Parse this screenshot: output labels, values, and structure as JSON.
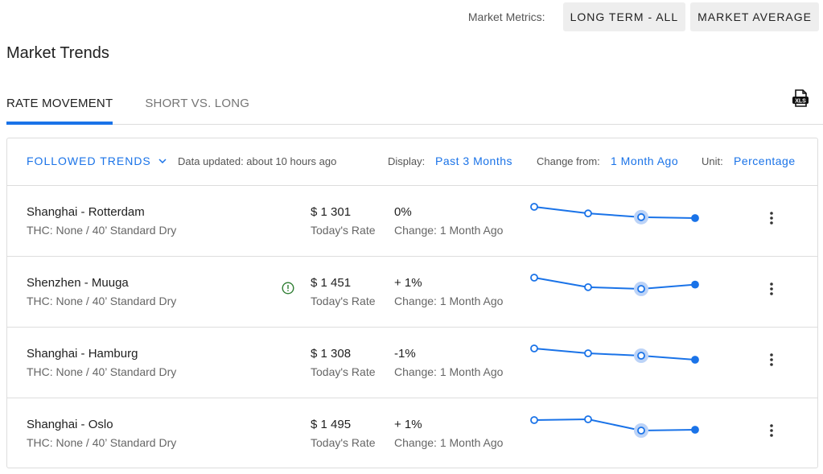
{
  "header": {
    "metrics_label": "Market Metrics:",
    "buttons": [
      "LONG TERM - ALL",
      "MARKET AVERAGE"
    ]
  },
  "page_title": "Market Trends",
  "tabs": [
    {
      "label": "RATE MOVEMENT",
      "active": true
    },
    {
      "label": "SHORT VS. LONG",
      "active": false
    }
  ],
  "export_icon": "xls-export-icon",
  "toolbar": {
    "followed": "FOLLOWED TRENDS",
    "updated": "Data updated: about 10 hours ago",
    "display_label": "Display:",
    "display_value": "Past 3 Months",
    "change_label": "Change from:",
    "change_value": "1 Month Ago",
    "unit_label": "Unit:",
    "unit_value": "Percentage"
  },
  "colors": {
    "accent": "#1a73e8",
    "warning": "#2e7d32"
  },
  "rows": [
    {
      "route": "Shanghai - Rotterdam",
      "details": "THC: None / 40’ Standard Dry",
      "rate": "$ 1 301",
      "rate_label": "Today's Rate",
      "change": "0%",
      "change_label": "Change: 1 Month Ago",
      "warning": false,
      "trend": [
        1301,
        1294,
        1290,
        1289
      ]
    },
    {
      "route": "Shenzhen - Muuga",
      "details": "THC: None / 40’ Standard Dry",
      "rate": "$ 1 451",
      "rate_label": "Today's Rate",
      "change": "+ 1%",
      "change_label": "Change: 1 Month Ago",
      "warning": true,
      "trend": [
        1451,
        1440,
        1438,
        1443
      ]
    },
    {
      "route": "Shanghai - Hamburg",
      "details": "THC: None / 40’ Standard Dry",
      "rate": "$ 1 308",
      "rate_label": "Today's Rate",
      "change": "-1%",
      "change_label": "Change: 1 Month Ago",
      "warning": false,
      "trend": [
        1321,
        1315,
        1312,
        1307
      ]
    },
    {
      "route": "Shanghai - Oslo",
      "details": "THC: None / 40’ Standard Dry",
      "rate": "$ 1 495",
      "rate_label": "Today's Rate",
      "change": "+ 1%",
      "change_label": "Change: 1 Month Ago",
      "warning": false,
      "trend": [
        1482,
        1483,
        1469,
        1470
      ]
    }
  ]
}
